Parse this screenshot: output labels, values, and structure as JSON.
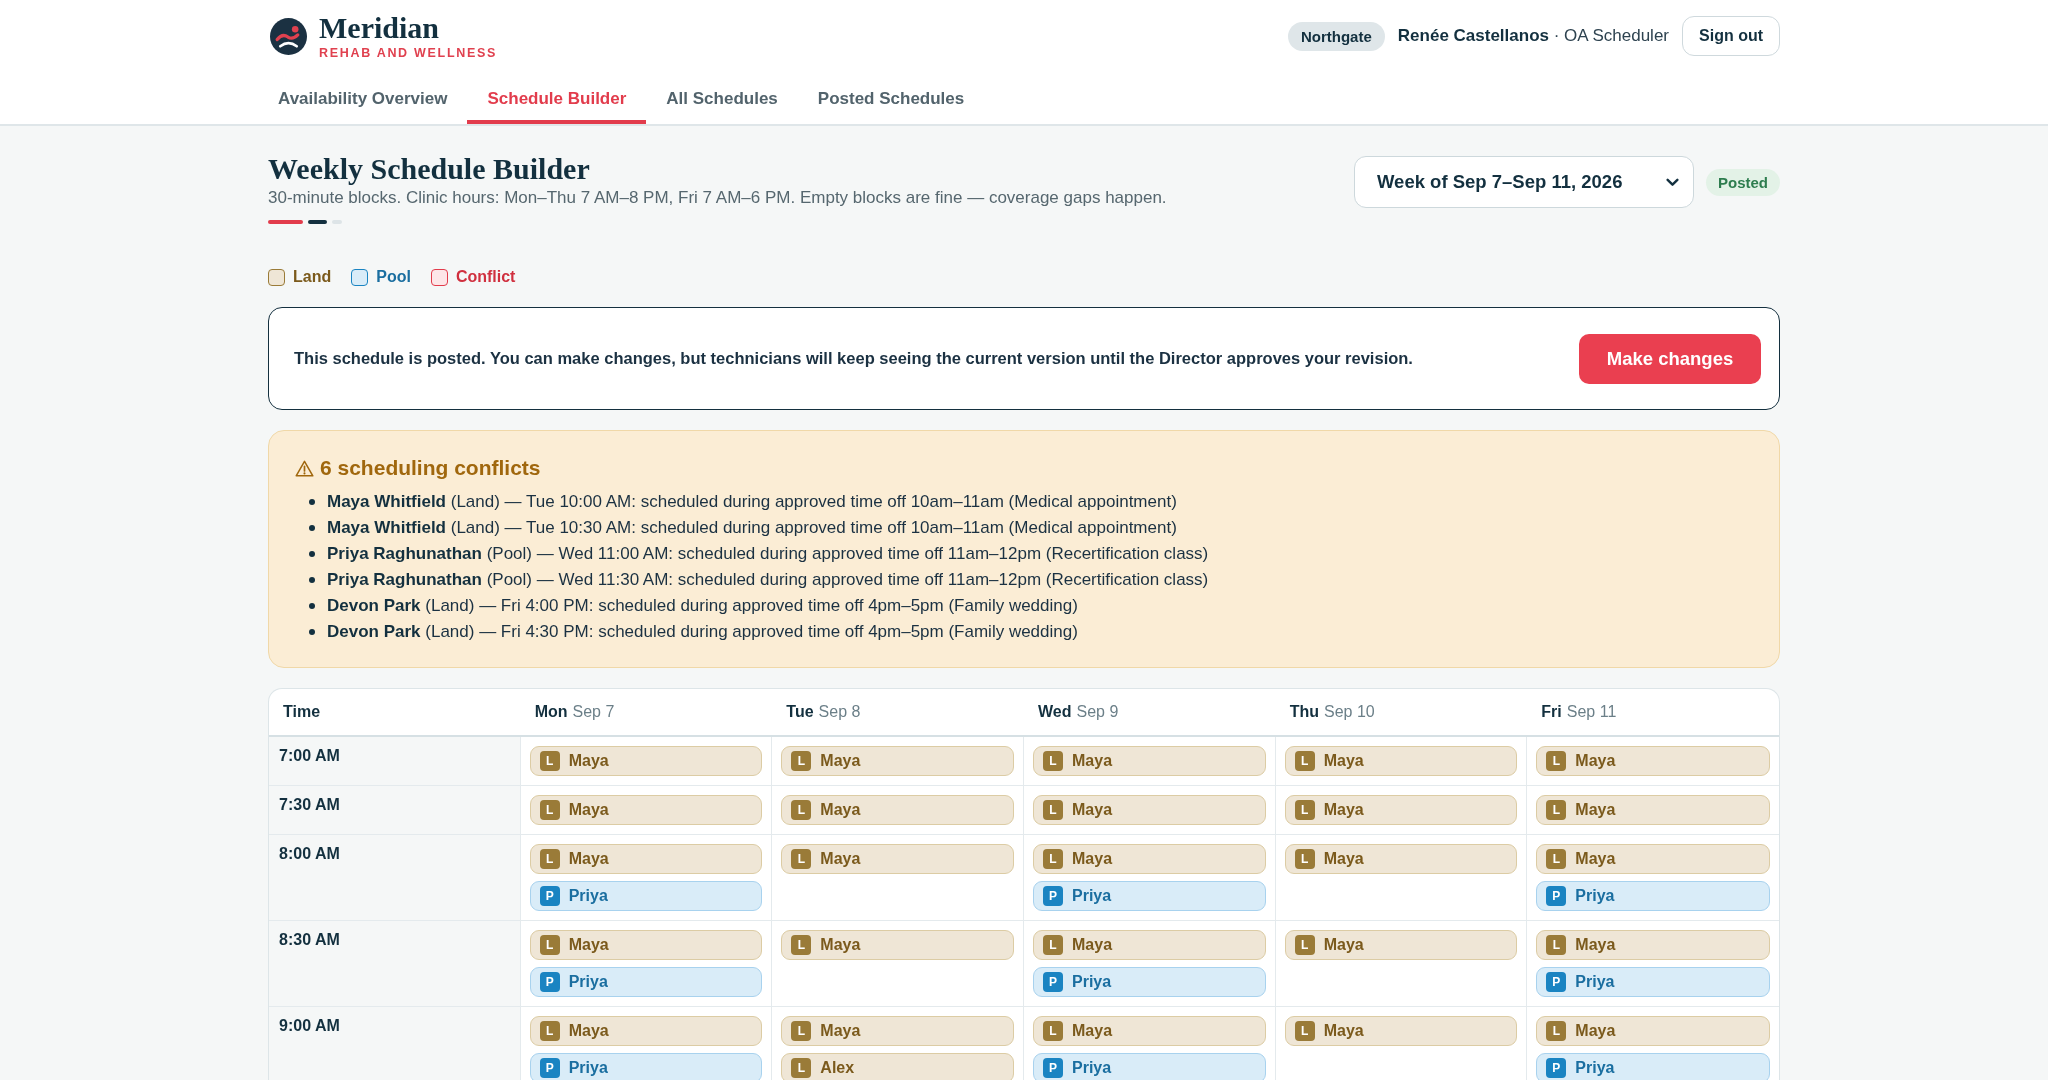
{
  "brand": {
    "name": "Meridian",
    "tagline": "REHAB AND WELLNESS"
  },
  "account": {
    "location": "Northgate",
    "user": "**Renée Castellanos** · OA Scheduler",
    "sign_out": "Sign out"
  },
  "tabs": [
    {
      "label": "Availability Overview",
      "selected": false
    },
    {
      "label": "Schedule Builder",
      "selected": true
    },
    {
      "label": "All Schedules",
      "selected": false
    },
    {
      "label": "Posted Schedules",
      "selected": false
    }
  ],
  "page": {
    "title": "Weekly Schedule Builder",
    "subtitle": "30-minute blocks. Clinic hours: Mon–Thu 7 AM–8 PM, Fri 7 AM–6 PM. Empty blocks are fine — coverage gaps happen.",
    "week": "Week of Sep 7–Sep 11, 2026",
    "status": "Posted"
  },
  "legend": [
    {
      "kind": "land",
      "label": "Land"
    },
    {
      "kind": "pool",
      "label": "Pool"
    },
    {
      "kind": "conflict",
      "label": "Conflict"
    }
  ],
  "notice": {
    "text": "This schedule is posted. You can make changes, but technicians will keep seeing the current version until the Director approves your revision.",
    "button": "Make changes"
  },
  "conflicts": {
    "title": "6 scheduling conflicts",
    "items": [
      "**Maya Whitfield** (Land) — Tue 10:00 AM: scheduled during approved time off 10am–11am (Medical appointment)",
      "**Maya Whitfield** (Land) — Tue 10:30 AM: scheduled during approved time off 10am–11am (Medical appointment)",
      "**Priya Raghunathan** (Pool) — Wed 11:00 AM: scheduled during approved time off 11am–12pm (Recertification class)",
      "**Priya Raghunathan** (Pool) — Wed 11:30 AM: scheduled during approved time off 11am–12pm (Recertification class)",
      "**Devon Park** (Land) — Fri 4:00 PM: scheduled during approved time off 4pm–5pm (Family wedding)",
      "**Devon Park** (Land) — Fri 4:30 PM: scheduled during approved time off 4pm–5pm (Family wedding)"
    ]
  },
  "schedule": {
    "time_heading": "Time",
    "days": [
      {
        "day": "Mon",
        "date": "Sep 7"
      },
      {
        "day": "Tue",
        "date": "Sep 8"
      },
      {
        "day": "Wed",
        "date": "Sep 9"
      },
      {
        "day": "Thu",
        "date": "Sep 10"
      },
      {
        "day": "Fri",
        "date": "Sep 11"
      }
    ],
    "rows": [
      {
        "time": "7:00 AM",
        "cells": [
          [
            {
              "kind": "land",
              "tag": "L",
              "name": "Maya"
            }
          ],
          [
            {
              "kind": "land",
              "tag": "L",
              "name": "Maya"
            }
          ],
          [
            {
              "kind": "land",
              "tag": "L",
              "name": "Maya"
            }
          ],
          [
            {
              "kind": "land",
              "tag": "L",
              "name": "Maya"
            }
          ],
          [
            {
              "kind": "land",
              "tag": "L",
              "name": "Maya"
            }
          ]
        ]
      },
      {
        "time": "7:30 AM",
        "cells": [
          [
            {
              "kind": "land",
              "tag": "L",
              "name": "Maya"
            }
          ],
          [
            {
              "kind": "land",
              "tag": "L",
              "name": "Maya"
            }
          ],
          [
            {
              "kind": "land",
              "tag": "L",
              "name": "Maya"
            }
          ],
          [
            {
              "kind": "land",
              "tag": "L",
              "name": "Maya"
            }
          ],
          [
            {
              "kind": "land",
              "tag": "L",
              "name": "Maya"
            }
          ]
        ]
      },
      {
        "time": "8:00 AM",
        "cells": [
          [
            {
              "kind": "land",
              "tag": "L",
              "name": "Maya"
            },
            {
              "kind": "pool",
              "tag": "P",
              "name": "Priya"
            }
          ],
          [
            {
              "kind": "land",
              "tag": "L",
              "name": "Maya"
            }
          ],
          [
            {
              "kind": "land",
              "tag": "L",
              "name": "Maya"
            },
            {
              "kind": "pool",
              "tag": "P",
              "name": "Priya"
            }
          ],
          [
            {
              "kind": "land",
              "tag": "L",
              "name": "Maya"
            }
          ],
          [
            {
              "kind": "land",
              "tag": "L",
              "name": "Maya"
            },
            {
              "kind": "pool",
              "tag": "P",
              "name": "Priya"
            }
          ]
        ]
      },
      {
        "time": "8:30 AM",
        "cells": [
          [
            {
              "kind": "land",
              "tag": "L",
              "name": "Maya"
            },
            {
              "kind": "pool",
              "tag": "P",
              "name": "Priya"
            }
          ],
          [
            {
              "kind": "land",
              "tag": "L",
              "name": "Maya"
            }
          ],
          [
            {
              "kind": "land",
              "tag": "L",
              "name": "Maya"
            },
            {
              "kind": "pool",
              "tag": "P",
              "name": "Priya"
            }
          ],
          [
            {
              "kind": "land",
              "tag": "L",
              "name": "Maya"
            }
          ],
          [
            {
              "kind": "land",
              "tag": "L",
              "name": "Maya"
            },
            {
              "kind": "pool",
              "tag": "P",
              "name": "Priya"
            }
          ]
        ]
      },
      {
        "time": "9:00 AM",
        "cells": [
          [
            {
              "kind": "land",
              "tag": "L",
              "name": "Maya"
            },
            {
              "kind": "pool",
              "tag": "P",
              "name": "Priya"
            }
          ],
          [
            {
              "kind": "land",
              "tag": "L",
              "name": "Maya"
            },
            {
              "kind": "land",
              "tag": "L",
              "name": "Alex"
            }
          ],
          [
            {
              "kind": "land",
              "tag": "L",
              "name": "Maya"
            },
            {
              "kind": "pool",
              "tag": "P",
              "name": "Priya"
            }
          ],
          [
            {
              "kind": "land",
              "tag": "L",
              "name": "Maya"
            }
          ],
          [
            {
              "kind": "land",
              "tag": "L",
              "name": "Maya"
            },
            {
              "kind": "pool",
              "tag": "P",
              "name": "Priya"
            }
          ]
        ]
      }
    ]
  }
}
